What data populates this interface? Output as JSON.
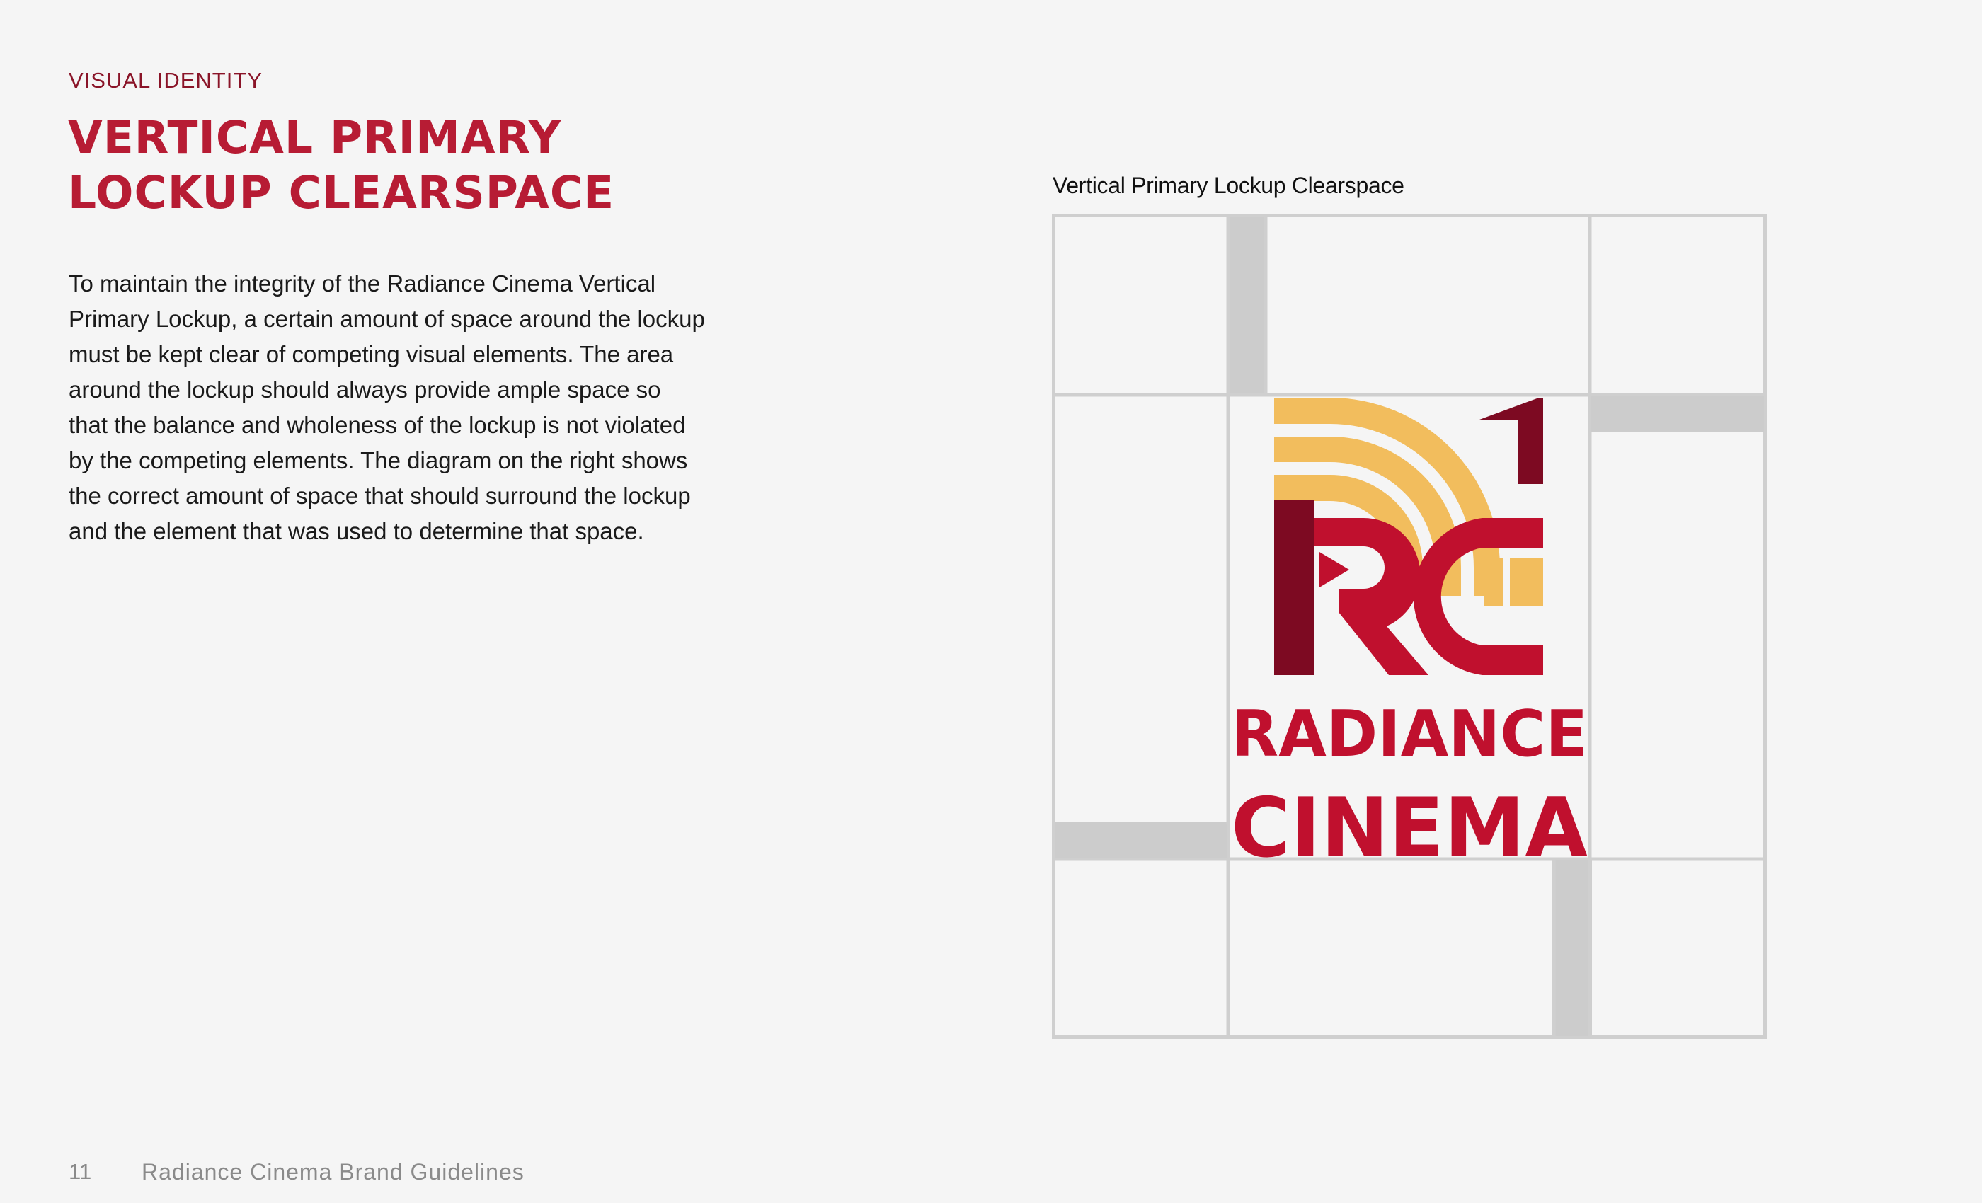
{
  "header": {
    "section_label": "VISUAL IDENTITY",
    "title": "VERTICAL PRIMARY\nLOCKUP CLEARSPACE"
  },
  "body": {
    "paragraph": "To maintain the integrity of the Radiance Cinema Vertical Primary Lockup, a certain amount of space around the lockup must be kept clear of competing visual elements. The area around the lockup should always provide ample space so that the balance and wholeness of the lockup is not violated by the competing elements. The diagram on the right shows the correct amount of space that should surround the lockup and the element that was used to determine that space."
  },
  "diagram": {
    "caption": "Vertical Primary Lockup Clearspace",
    "logo": {
      "monogram": "RC",
      "wordmark_line1": "RADIANCE",
      "wordmark_line2": "CINEMA"
    },
    "colors": {
      "grid_line": "#cfcfcf",
      "clearspace_fill": "#cccccc",
      "cell_fill": "#f5f5f5",
      "logo_gold": "#f2bd5d",
      "logo_red": "#c0102e",
      "logo_dark_red": "#7d0a22"
    }
  },
  "footer": {
    "page_number": "11",
    "document_title": "Radiance Cinema Brand Guidelines"
  },
  "colors": {
    "accent": "#b71c34",
    "section_label": "#8a1428",
    "background": "#f5f5f5"
  }
}
